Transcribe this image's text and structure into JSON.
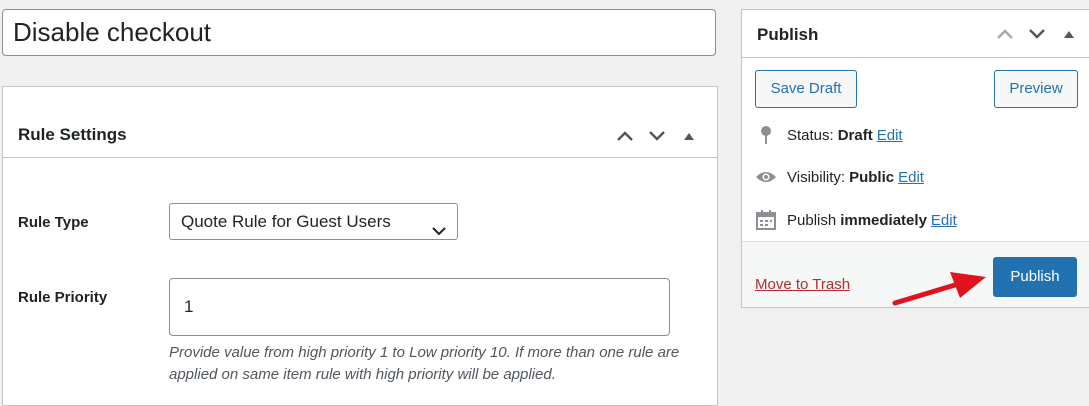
{
  "post": {
    "title": "Disable checkout"
  },
  "rule_settings": {
    "heading": "Rule Settings",
    "rule_type_label": "Rule Type",
    "rule_type_value": "Quote Rule for Guest Users",
    "priority_label": "Rule Priority",
    "priority_value": "1",
    "priority_help": "Provide value from high priority 1 to Low priority 10. If more than one rule are applied on same item rule with high priority will be applied."
  },
  "publish": {
    "heading": "Publish",
    "save_draft": "Save Draft",
    "preview": "Preview",
    "status_label": "Status:",
    "status_value": "Draft",
    "visibility_label": "Visibility:",
    "visibility_value": "Public",
    "publish_label": "Publish",
    "publish_value": "immediately",
    "edit": "Edit",
    "move_to_trash": "Move to Trash",
    "publish_button": "Publish"
  },
  "colors": {
    "primary": "#2271b1",
    "danger": "#b32d2e",
    "annotation_arrow": "#e0141e"
  },
  "icons": [
    "chevron-up-icon",
    "chevron-down-icon",
    "triangle-up-icon",
    "pin-icon",
    "eye-icon",
    "calendar-icon",
    "annotation-arrow"
  ]
}
